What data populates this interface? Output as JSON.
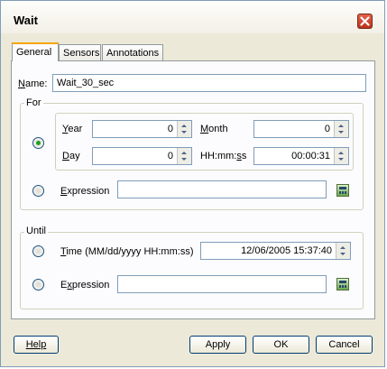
{
  "window": {
    "title": "Wait"
  },
  "tabs": [
    {
      "label": "General",
      "active": true
    },
    {
      "label": "Sensors",
      "active": false
    },
    {
      "label": "Annotations",
      "active": false
    }
  ],
  "name": {
    "label": "Name:",
    "value": "Wait_30_sec"
  },
  "for_group": {
    "title": "For",
    "year": {
      "label": "Year",
      "value": "0"
    },
    "month": {
      "label": "Month",
      "value": "0"
    },
    "day": {
      "label": "Day",
      "value": "0"
    },
    "time": {
      "label": "HH:mm:ss",
      "value": "00:00:31"
    },
    "expression": {
      "label": "Expression",
      "value": ""
    },
    "selected": "duration"
  },
  "until_group": {
    "title": "Until",
    "time": {
      "label": "Time (MM/dd/yyyy HH:mm:ss)",
      "value": "12/06/2005 15:37:40"
    },
    "expression": {
      "label": "Expression",
      "value": ""
    }
  },
  "buttons": {
    "help": "Help",
    "apply": "Apply",
    "ok": "OK",
    "cancel": "Cancel"
  },
  "colors": {
    "accent_tab": "#f6a600",
    "radio_dot": "#20a020",
    "close": "#c8402a"
  }
}
